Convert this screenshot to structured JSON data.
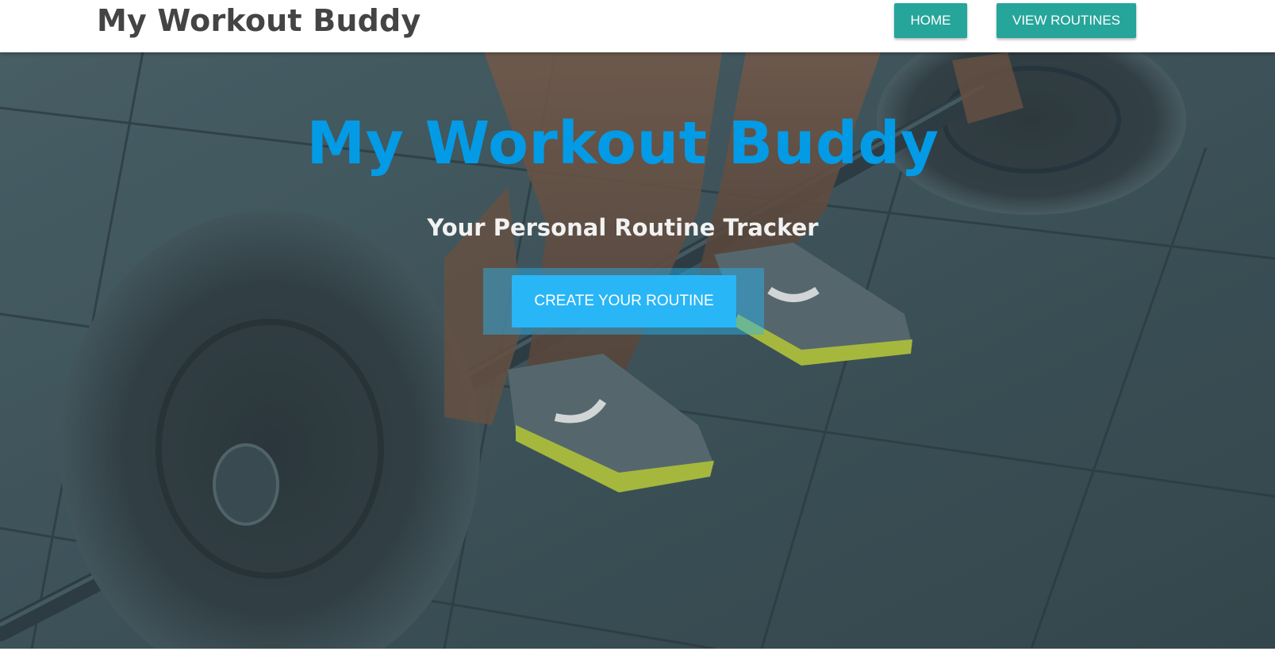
{
  "navbar": {
    "brand": "My Workout Buddy",
    "links": {
      "home": "HOME",
      "view_routines": "VIEW ROUTINES"
    }
  },
  "hero": {
    "title": "My Workout Buddy",
    "subtitle": "Your Personal Routine Tracker",
    "cta_label": "CREATE YOUR ROUTINE"
  },
  "colors": {
    "nav_button": "#26a69a",
    "hero_title": "#039be5",
    "cta_button": "#29b6f6",
    "brand_text": "#444444"
  }
}
